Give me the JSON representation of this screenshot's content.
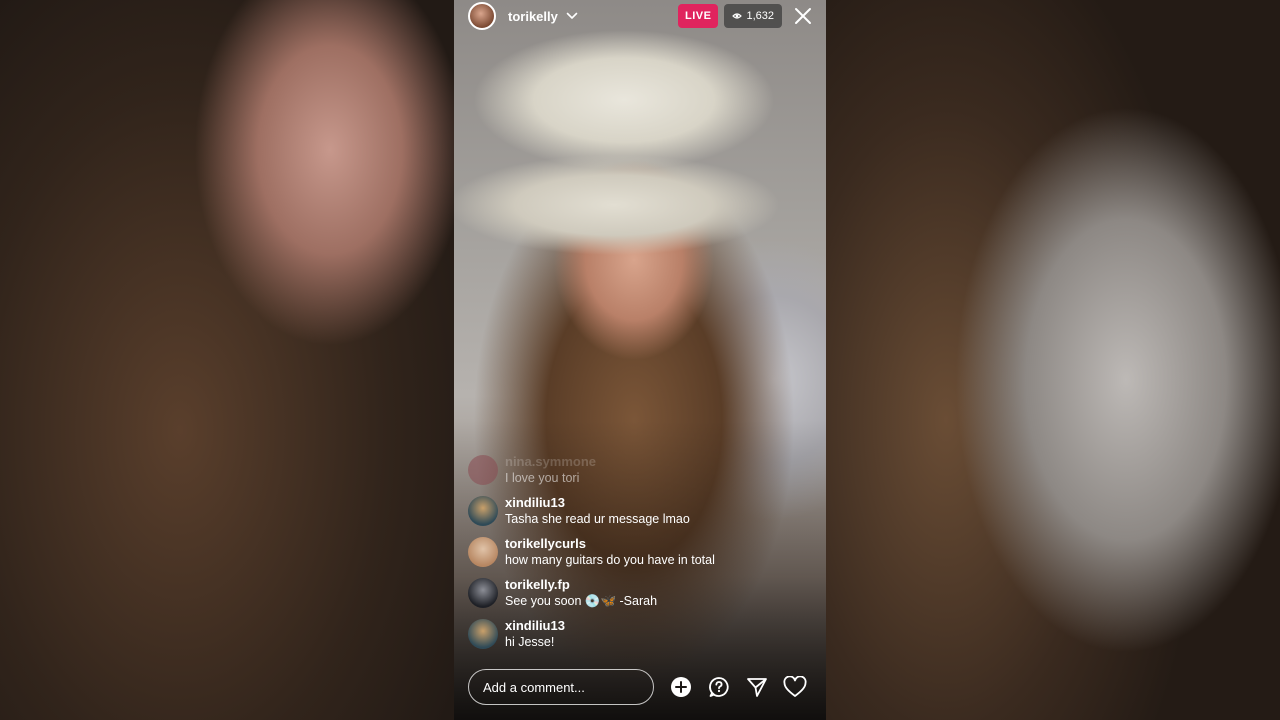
{
  "header": {
    "username": "torikelly",
    "live_label": "LIVE",
    "viewer_count": "1,632"
  },
  "comments": [
    {
      "user": "nina.symmone",
      "text": "I love you tori",
      "avatar_color": "#8a4b52",
      "faded": true
    },
    {
      "user": "xindiliu13",
      "text": "Tasha she read ur message lmao",
      "avatar_color": "#2f4a57",
      "faded": false
    },
    {
      "user": "torikellycurls",
      "text": "how many guitars do you have in total",
      "avatar_color": "#b78762",
      "faded": false
    },
    {
      "user": "torikelly.fp",
      "text": "See you soon 💿🦋 -Sarah",
      "avatar_color": "#4d4f58",
      "faded": false
    },
    {
      "user": "xindiliu13",
      "text": "hi Jesse!",
      "avatar_color": "#2f4a57",
      "faded": false
    }
  ],
  "composer": {
    "placeholder": "Add a comment..."
  },
  "icons": {
    "add": "plus-circle-icon",
    "question": "question-icon",
    "share": "send-icon",
    "like": "heart-icon"
  },
  "colors": {
    "live_badge": "#e0245e"
  }
}
